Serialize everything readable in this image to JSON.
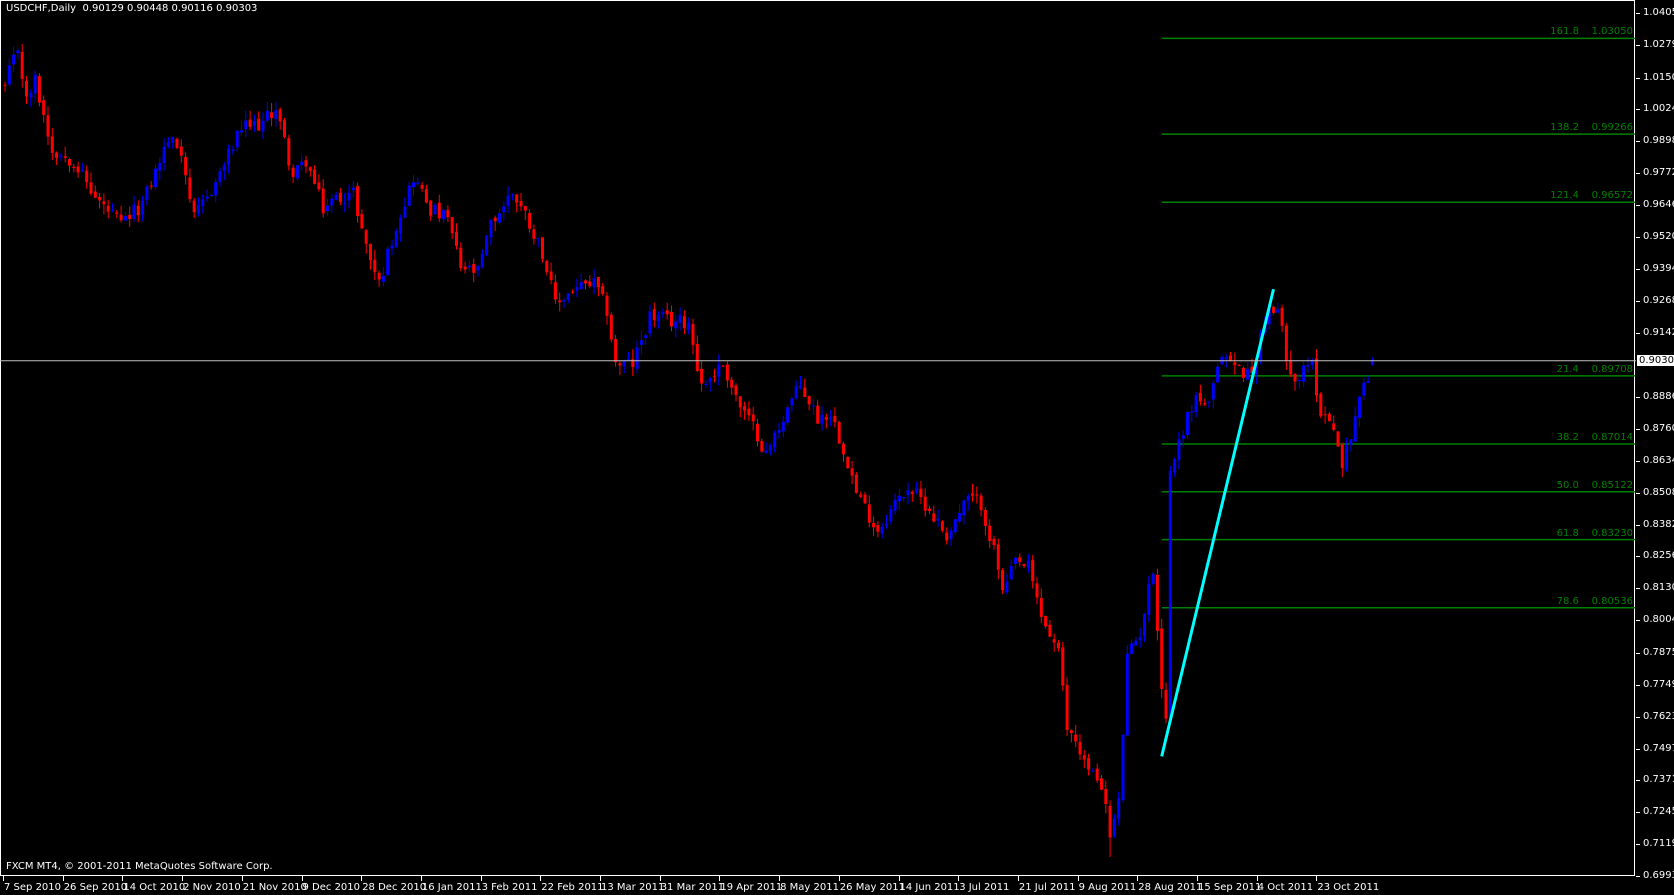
{
  "header": {
    "symbol": "USDCHF,Daily",
    "ohlc": "0.90129 0.90448 0.90116 0.90303"
  },
  "footer": {
    "copyright": "FXCM MT4, © 2001-2011 MetaQuotes Software Corp."
  },
  "colors": {
    "bull": "#0000ff",
    "bear": "#ff0000",
    "fib": "#008000",
    "trendline": "#00ffff",
    "price_line": "#c0c0c0"
  },
  "chart_data": {
    "type": "candlestick",
    "title": "USDCHF,Daily",
    "ylim": [
      0.6993,
      1.04055
    ],
    "y_ticks": [
      "1.04055",
      "1.02795",
      "1.01500",
      "1.00240",
      "0.98980",
      "0.97720",
      "0.96460",
      "0.95200",
      "0.93940",
      "0.92680",
      "0.91420",
      "0.88865",
      "0.87605",
      "0.86345",
      "0.85085",
      "0.83825",
      "0.82565",
      "0.81305",
      "0.80045",
      "0.78750",
      "0.77490",
      "0.76230",
      "0.74970",
      "0.73710",
      "0.72450",
      "0.71190",
      "0.69930"
    ],
    "x_ticks": [
      "7 Sep 2010",
      "26 Sep 2010",
      "14 Oct 2010",
      "2 Nov 2010",
      "21 Nov 2010",
      "9 Dec 2010",
      "28 Dec 2010",
      "16 Jan 2011",
      "3 Feb 2011",
      "22 Feb 2011",
      "13 Mar 2011",
      "31 Mar 2011",
      "19 Apr 2011",
      "8 May 2011",
      "26 May 2011",
      "14 Jun 2011",
      "3 Jul 2011",
      "21 Jul 2011",
      "9 Aug 2011",
      "28 Aug 2011",
      "15 Sep 2011",
      "4 Oct 2011",
      "23 Oct 2011"
    ],
    "bar_count": 319,
    "close_keypoints": [
      [
        0,
        1.0119
      ],
      [
        3,
        1.0267
      ],
      [
        5,
        1.0055
      ],
      [
        7,
        1.014
      ],
      [
        11,
        0.9864
      ],
      [
        16,
        0.9822
      ],
      [
        21,
        0.9674
      ],
      [
        27,
        0.9568
      ],
      [
        32,
        0.9652
      ],
      [
        38,
        0.9907
      ],
      [
        41,
        0.9864
      ],
      [
        44,
        0.9589
      ],
      [
        49,
        0.9737
      ],
      [
        55,
        0.9949
      ],
      [
        60,
        0.997
      ],
      [
        63,
        1.0034
      ],
      [
        67,
        0.9758
      ],
      [
        70,
        0.9822
      ],
      [
        74,
        0.9631
      ],
      [
        77,
        0.9674
      ],
      [
        81,
        0.9695
      ],
      [
        84,
        0.9483
      ],
      [
        87,
        0.9335
      ],
      [
        91,
        0.9568
      ],
      [
        95,
        0.9758
      ],
      [
        99,
        0.9631
      ],
      [
        103,
        0.9589
      ],
      [
        106,
        0.9398
      ],
      [
        110,
        0.9377
      ],
      [
        113,
        0.9568
      ],
      [
        118,
        0.97
      ],
      [
        121,
        0.961
      ],
      [
        125,
        0.9462
      ],
      [
        128,
        0.925
      ],
      [
        132,
        0.9313
      ],
      [
        137,
        0.9335
      ],
      [
        140,
        0.9229
      ],
      [
        142,
        0.9017
      ],
      [
        146,
        0.9017
      ],
      [
        150,
        0.9208
      ],
      [
        155,
        0.9186
      ],
      [
        159,
        0.9186
      ],
      [
        162,
        0.8932
      ],
      [
        167,
        0.9017
      ],
      [
        171,
        0.8847
      ],
      [
        175,
        0.8741
      ],
      [
        177,
        0.8657
      ],
      [
        182,
        0.8847
      ],
      [
        185,
        0.8932
      ],
      [
        189,
        0.8805
      ],
      [
        192,
        0.8826
      ],
      [
        196,
        0.8636
      ],
      [
        198,
        0.8508
      ],
      [
        203,
        0.836
      ],
      [
        207,
        0.8466
      ],
      [
        210,
        0.853
      ],
      [
        214,
        0.8466
      ],
      [
        219,
        0.8339
      ],
      [
        224,
        0.8487
      ],
      [
        227,
        0.8466
      ],
      [
        231,
        0.8212
      ],
      [
        232,
        0.8106
      ],
      [
        235,
        0.8233
      ],
      [
        238,
        0.8212
      ],
      [
        241,
        0.8021
      ],
      [
        245,
        0.7873
      ],
      [
        247,
        0.7576
      ],
      [
        249,
        0.7534
      ],
      [
        252,
        0.7407
      ],
      [
        255,
        0.7364
      ],
      [
        257,
        0.715
      ],
      [
        259,
        0.728
      ],
      [
        261,
        0.7852
      ],
      [
        264,
        0.7958
      ],
      [
        267,
        0.8212
      ],
      [
        269,
        0.7746
      ],
      [
        270,
        0.7619
      ],
      [
        271,
        0.8593
      ],
      [
        274,
        0.8763
      ],
      [
        277,
        0.889
      ],
      [
        280,
        0.8847
      ],
      [
        283,
        0.9059
      ],
      [
        287,
        0.8996
      ],
      [
        290,
        0.8975
      ],
      [
        293,
        0.9208
      ],
      [
        296,
        0.9229
      ],
      [
        298,
        0.9059
      ],
      [
        300,
        0.8953
      ],
      [
        304,
        0.9017
      ],
      [
        306,
        0.8826
      ],
      [
        309,
        0.8784
      ],
      [
        311,
        0.8593
      ],
      [
        312,
        0.8678
      ],
      [
        315,
        0.889
      ],
      [
        317,
        0.8953
      ],
      [
        318,
        0.903
      ]
    ],
    "current_price": "0.90303",
    "fibonacci": {
      "start_bar": 269,
      "levels": [
        {
          "level": "161.8",
          "price": "1.03050"
        },
        {
          "level": "138.2",
          "price": "0.99266"
        },
        {
          "level": "121.4",
          "price": "0.96572"
        },
        {
          "level": "21.4",
          "price": "0.89708"
        },
        {
          "level": "38.2",
          "price": "0.87014"
        },
        {
          "level": "50.0",
          "price": "0.85122"
        },
        {
          "level": "61.8",
          "price": "0.83230"
        },
        {
          "level": "78.6",
          "price": "0.80536"
        }
      ]
    },
    "trendline": {
      "from": [
        269,
        0.7466
      ],
      "to": [
        295,
        0.9313
      ]
    }
  }
}
